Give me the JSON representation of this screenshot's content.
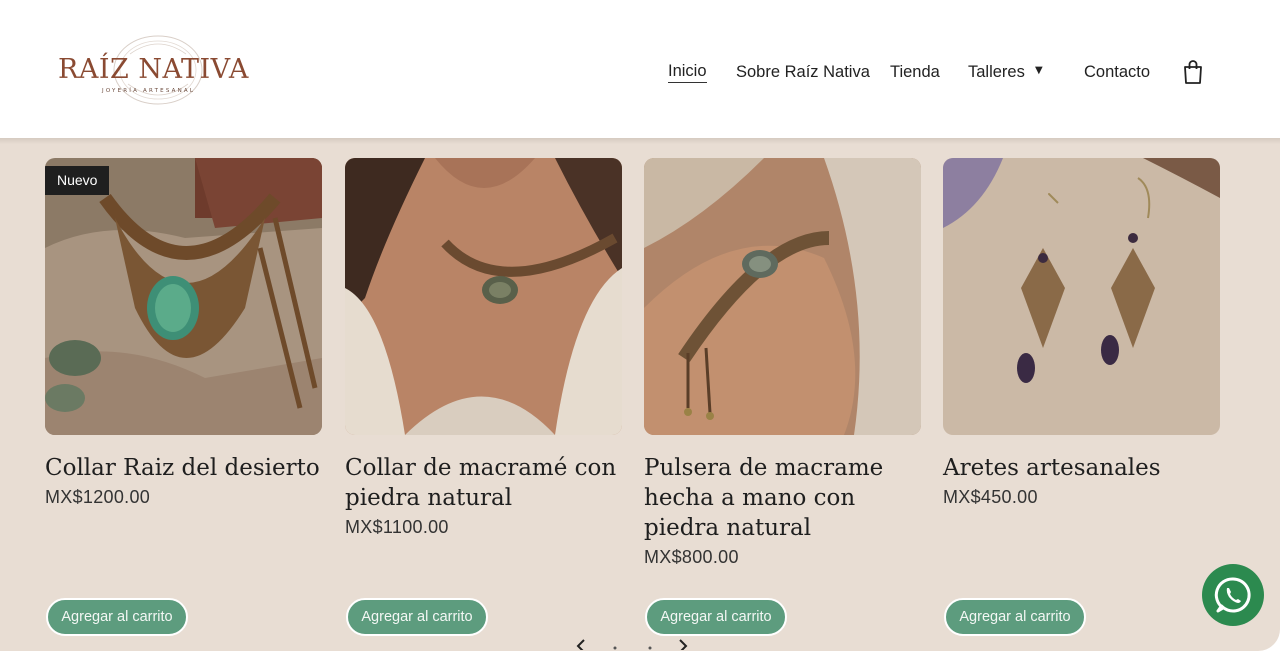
{
  "brand": {
    "name": "RAÍZ NATIVA",
    "tagline": "JOYERÍA ARTESANAL",
    "accent_color": "#8a4a32"
  },
  "nav": {
    "items": [
      {
        "label": "Inicio",
        "active": true
      },
      {
        "label": "Sobre Raíz Nativa",
        "active": false
      },
      {
        "label": "Tienda",
        "active": false
      },
      {
        "label": "Talleres",
        "active": false,
        "has_dropdown": true
      },
      {
        "label": "Contacto",
        "active": false
      }
    ],
    "cart_icon": "shopping-bag-icon"
  },
  "products": [
    {
      "title": "Collar Raiz del desierto",
      "price": "MX$1200.00",
      "badge": "Nuevo",
      "button": "Agregar al carrito"
    },
    {
      "title": "Collar de macramé con piedra natural",
      "price": "MX$1100.00",
      "button": "Agregar al carrito"
    },
    {
      "title": "Pulsera de macrame hecha a mano con piedra natural",
      "price": "MX$800.00",
      "button": "Agregar al carrito"
    },
    {
      "title": "Aretes artesanales",
      "price": "MX$450.00",
      "button": "Agregar al carrito"
    }
  ],
  "colors": {
    "page_background": "#e8ddd3",
    "button": "#5d9c7e",
    "whatsapp": "#2c8a4f"
  },
  "floating": {
    "whatsapp_icon": "whatsapp-icon"
  }
}
